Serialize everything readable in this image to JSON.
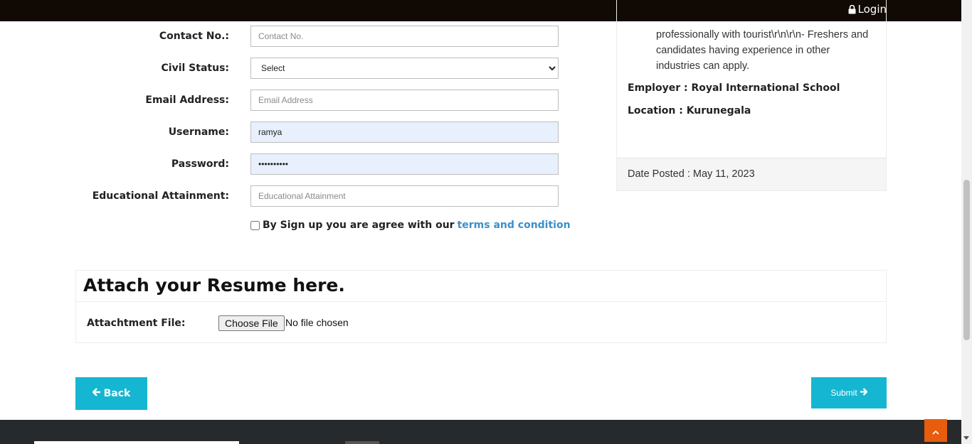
{
  "header": {
    "login_label": "Login"
  },
  "form": {
    "contact": {
      "label": "Contact No.:",
      "placeholder": "Contact No."
    },
    "civil_status": {
      "label": "Civil Status:",
      "selected": "Select"
    },
    "email": {
      "label": "Email Address:",
      "placeholder": "Email Address"
    },
    "username": {
      "label": "Username:",
      "value": "ramya"
    },
    "password": {
      "label": "Password:",
      "value": "••••••••••"
    },
    "education": {
      "label": "Educational Attainment:",
      "placeholder": "Educational Attainment"
    },
    "agree_text": "By Sign up you are agree with our",
    "terms_link": "terms and condition"
  },
  "job": {
    "description": "professionally with tourist\\r\\n\\r\\n- Freshers and candidates having experience in other industries can apply.",
    "employer": "Employer : Royal International School",
    "location": "Location : Kurunegala",
    "date_posted": "Date Posted : May 11, 2023"
  },
  "resume": {
    "heading": "Attach your Resume here.",
    "attach_label": "Attachtment File:",
    "choose_file": "Choose File",
    "file_status": "No file chosen"
  },
  "actions": {
    "back_label": "Back",
    "submit_label": "Submit"
  },
  "colors": {
    "accent": "#15b6d1",
    "link": "#3a8fc9",
    "top_button": "#e85c0d",
    "topbar": "#110a04",
    "footer": "#272a2c"
  },
  "icons": {
    "login": "lock-icon",
    "back": "arrow-left-icon",
    "submit": "arrow-right-icon",
    "to_top": "chevron-up-icon"
  }
}
